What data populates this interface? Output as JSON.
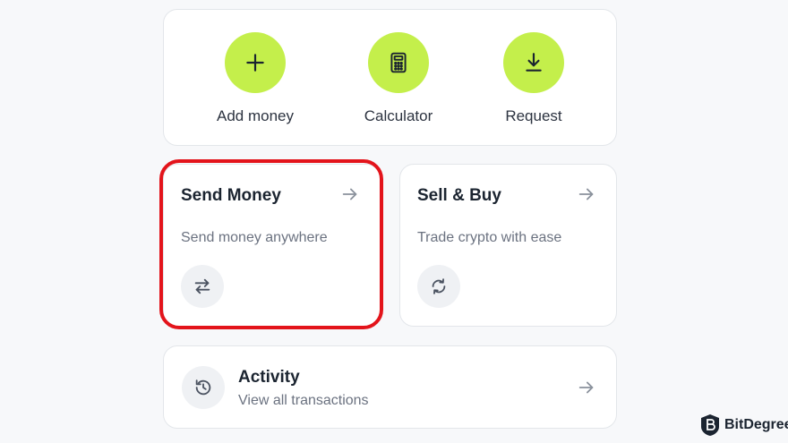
{
  "quick_actions": [
    {
      "label": "Add money",
      "icon": "plus-icon"
    },
    {
      "label": "Calculator",
      "icon": "calculator-icon"
    },
    {
      "label": "Request",
      "icon": "download-icon"
    }
  ],
  "features": [
    {
      "title": "Send Money",
      "subtitle": "Send money anywhere",
      "icon": "swap-arrows-icon",
      "arrow_icon": "arrow-right-icon"
    },
    {
      "title": "Sell & Buy",
      "subtitle": "Trade crypto with ease",
      "icon": "refresh-icon",
      "arrow_icon": "arrow-right-icon"
    }
  ],
  "activity": {
    "title": "Activity",
    "subtitle": "View all transactions",
    "icon": "history-icon",
    "arrow_icon": "arrow-right-icon"
  },
  "watermark": {
    "text": "BitDegree",
    "icon": "bitdegree-logo-icon"
  },
  "colors": {
    "accent": "#c4ef4b",
    "highlight": "#e3141b",
    "title": "#1b2430",
    "subtitle": "#6b7280",
    "icon_bg": "#eff1f4"
  }
}
